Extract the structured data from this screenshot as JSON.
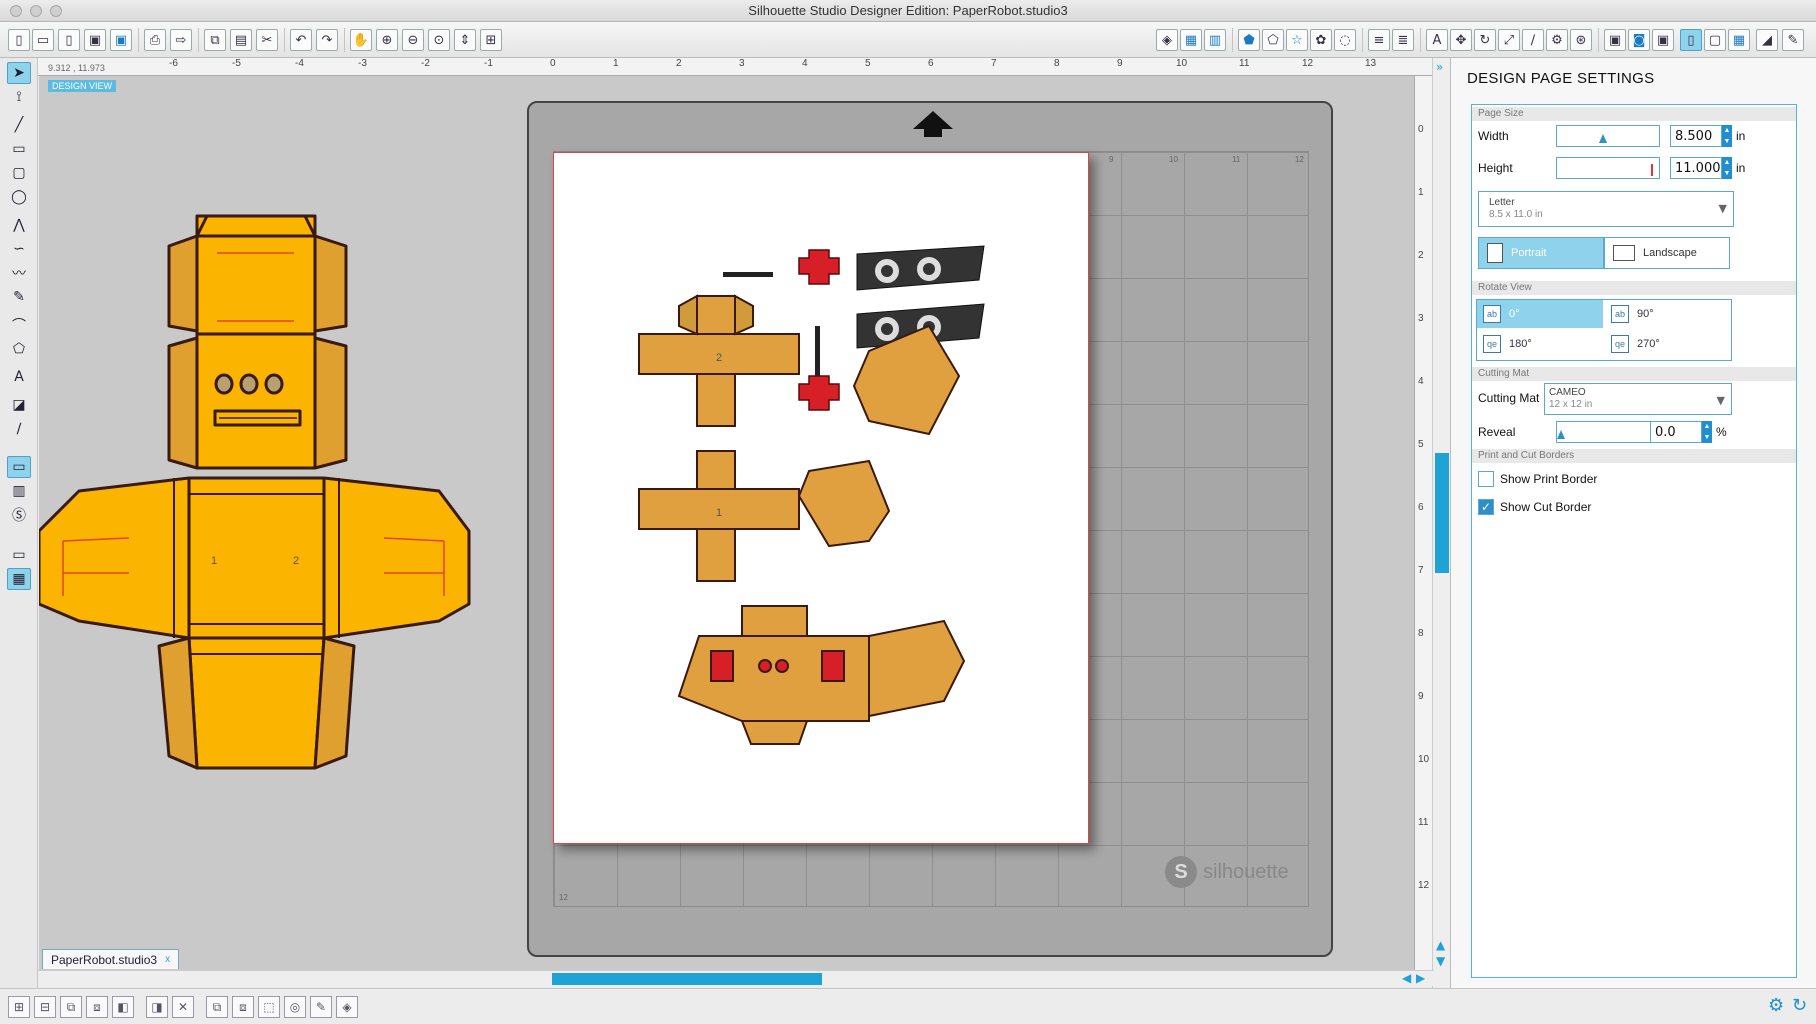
{
  "window": {
    "title": "Silhouette Studio Designer Edition: PaperRobot.studio3"
  },
  "toolbar": {
    "left_icons": [
      "new-document-icon",
      "open-folder-icon",
      "open-file-icon",
      "save-icon",
      "save-to-library-icon",
      "print-icon",
      "send-to-cutter-icon",
      "copy-icon",
      "paste-icon",
      "cut-icon",
      "undo-icon",
      "redo-icon",
      "pan-icon",
      "zoom-in-icon",
      "zoom-out-icon",
      "zoom-select-icon",
      "zoom-drag-icon",
      "fit-to-page-icon"
    ],
    "right_icons": [
      "fill-icon",
      "line-color-icon",
      "gradient-icon",
      "shape-icon",
      "pattern-icon",
      "star-icon",
      "offset-icon",
      "trace-icon",
      "align-icon",
      "replicate-icon",
      "text-icon",
      "transform-icon",
      "rotate-icon",
      "scale-icon",
      "knife-icon",
      "modify-icon",
      "weld-icon",
      "library-icon",
      "store-icon",
      "page-settings-icon",
      "cut-settings-icon",
      "grid-icon",
      "send-icon",
      "cut-icon-2"
    ]
  },
  "left_tools": [
    "select-icon",
    "point-edit-icon",
    "line-icon",
    "rectangle-icon",
    "rounded-rectangle-icon",
    "ellipse-icon",
    "polyline-icon",
    "curve-icon",
    "freehand-icon",
    "smooth-freehand-icon",
    "arc-icon",
    "polygon-icon",
    "text-tool-icon",
    "eraser-icon",
    "knife-tool-icon",
    "design-view-icon",
    "library-view-icon",
    "silhouette-store-icon",
    "cut-view-icon",
    "split-view-icon"
  ],
  "canvas": {
    "coords": "9.312 , 11.973",
    "view_label": "DESIGN VIEW",
    "ruler_h": [
      "-6",
      "-5",
      "-4",
      "-3",
      "-2",
      "-1",
      "0",
      "1",
      "2",
      "3",
      "4",
      "5",
      "6",
      "7",
      "8",
      "9",
      "10",
      "11",
      "12",
      "13"
    ],
    "ruler_v": [
      "0",
      "1",
      "2",
      "3",
      "4",
      "5",
      "6",
      "7",
      "8",
      "9",
      "10",
      "11",
      "12"
    ],
    "mat_ticks_top": [
      "9",
      "10",
      "11",
      "12"
    ],
    "mat_tick_bottom": "12",
    "watermark": "silhouette",
    "piece_labels": [
      "1",
      "2",
      "1",
      "2"
    ]
  },
  "document_tab": {
    "name": "PaperRobot.studio3",
    "close": "x"
  },
  "panel": {
    "title": "DESIGN PAGE SETTINGS",
    "page_size": {
      "header": "Page Size",
      "width_label": "Width",
      "width_value": "8.500",
      "width_unit": "in",
      "height_label": "Height",
      "height_value": "11.000",
      "height_unit": "in",
      "preset_name": "Letter",
      "preset_dims": "8.5 x 11.0 in",
      "portrait": "Portrait",
      "landscape": "Landscape",
      "selected": "Portrait"
    },
    "rotate": {
      "header": "Rotate View",
      "options": [
        "0°",
        "90°",
        "180°",
        "270°"
      ],
      "icons": [
        "ab",
        "ab",
        "qe",
        "qe"
      ],
      "selected": "0°"
    },
    "cutting_mat": {
      "header": "Cutting Mat",
      "label": "Cutting Mat",
      "value": "CAMEO",
      "value_dims": "12 x 12 in",
      "reveal_label": "Reveal",
      "reveal_value": "0.0",
      "reveal_unit": "%"
    },
    "borders": {
      "header": "Print and Cut Borders",
      "show_print_border": "Show Print Border",
      "show_print_border_checked": false,
      "show_cut_border": "Show Cut Border",
      "show_cut_border_checked": true
    }
  },
  "bottom_icons": [
    "group-icon",
    "ungroup-icon",
    "compound-path-icon",
    "release-compound-icon",
    "bring-forward-icon",
    "send-backward-icon",
    "delete-icon",
    "duplicate-icon",
    "mirror-icon",
    "lock-icon",
    "target-icon",
    "edit-points-icon",
    "import-icon"
  ],
  "colors": {
    "accent": "#1fa2d6",
    "selection": "#8fd2ec",
    "robot_body": "#fbb400",
    "robot_flap": "#e0a030",
    "robot_red": "#d61f26",
    "outline": "#3a1a10"
  }
}
